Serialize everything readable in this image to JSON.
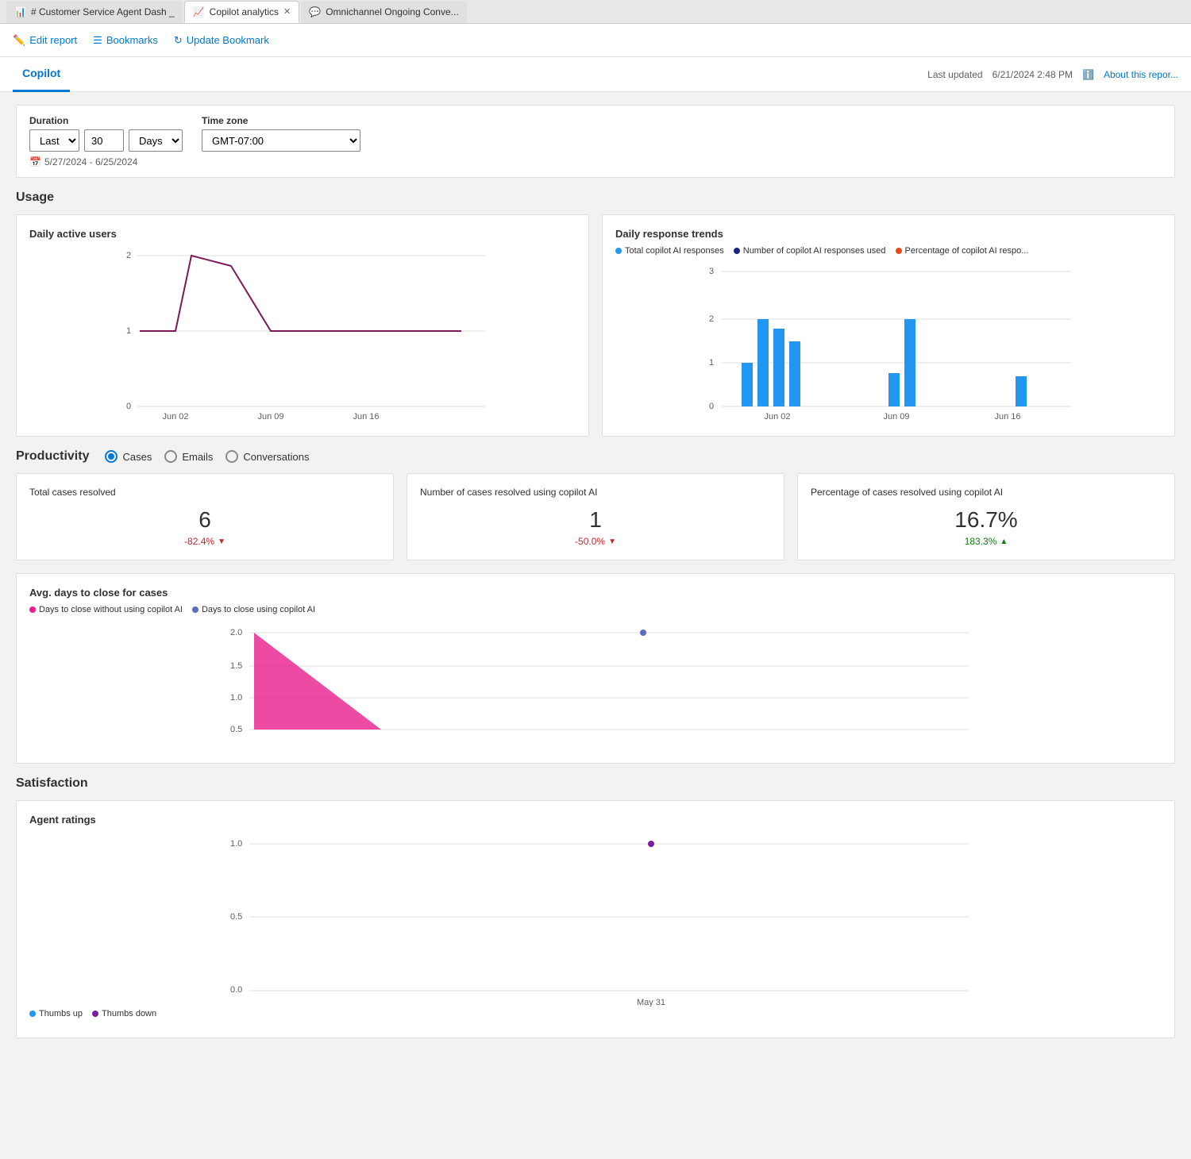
{
  "browser": {
    "tabs": [
      {
        "id": "tab1",
        "icon": "📊",
        "label": "# Customer Service Agent Dash _",
        "active": false,
        "closable": false
      },
      {
        "id": "tab2",
        "icon": "📈",
        "label": "Copilot analytics",
        "active": true,
        "closable": true
      },
      {
        "id": "tab3",
        "icon": "💬",
        "label": "Omnichannel Ongoing Conve...",
        "active": false,
        "closable": false
      }
    ]
  },
  "toolbar": {
    "edit_report": "Edit report",
    "bookmarks": "Bookmarks",
    "update_bookmark": "Update Bookmark"
  },
  "header": {
    "nav_tab": "Copilot",
    "last_updated_label": "Last updated",
    "last_updated_value": "6/21/2024 2:48 PM",
    "about_link": "About this repor..."
  },
  "filters": {
    "duration_label": "Duration",
    "duration_options": [
      "Last"
    ],
    "duration_value": "Last",
    "duration_number": "30",
    "duration_unit_options": [
      "Days"
    ],
    "duration_unit": "Days",
    "timezone_label": "Time zone",
    "timezone_value": "GMT-07:00",
    "date_range": "5/27/2024 - 6/25/2024"
  },
  "usage": {
    "section_title": "Usage",
    "daily_active_users": {
      "title": "Daily active users",
      "y_max": 2,
      "y_mid": 1,
      "y_min": 0,
      "x_labels": [
        "Jun 02",
        "Jun 09",
        "Jun 16"
      ],
      "data_points": [
        {
          "x": 0.12,
          "y": 1.0
        },
        {
          "x": 0.22,
          "y": 2.0
        },
        {
          "x": 0.32,
          "y": 1.8
        },
        {
          "x": 0.55,
          "y": 1.0
        },
        {
          "x": 0.7,
          "y": 1.0
        },
        {
          "x": 0.85,
          "y": 1.0
        },
        {
          "x": 1.0,
          "y": 1.0
        }
      ]
    },
    "daily_response_trends": {
      "title": "Daily response trends",
      "legend": [
        {
          "label": "Total copilot AI responses",
          "color": "#2196f3"
        },
        {
          "label": "Number of copilot AI responses used",
          "color": "#1a237e"
        },
        {
          "label": "Percentage of copilot AI respo...",
          "color": "#e64a19"
        }
      ],
      "y_labels": [
        "3",
        "2",
        "1",
        "0"
      ],
      "x_labels": [
        "Jun 02",
        "Jun 09",
        "Jun 16"
      ],
      "bars": [
        {
          "x_pos": 0.09,
          "height_ratio": 0.4,
          "color": "#2196f3"
        },
        {
          "x_pos": 0.13,
          "height_ratio": 0.65,
          "color": "#2196f3"
        },
        {
          "x_pos": 0.17,
          "height_ratio": 0.6,
          "color": "#2196f3"
        },
        {
          "x_pos": 0.21,
          "height_ratio": 0.5,
          "color": "#2196f3"
        },
        {
          "x_pos": 0.55,
          "height_ratio": 0.35,
          "color": "#2196f3"
        },
        {
          "x_pos": 0.59,
          "height_ratio": 0.65,
          "color": "#2196f3"
        },
        {
          "x_pos": 0.9,
          "height_ratio": 0.33,
          "color": "#2196f3"
        }
      ]
    }
  },
  "productivity": {
    "section_title": "Productivity",
    "radio_options": [
      "Cases",
      "Emails",
      "Conversations"
    ],
    "selected_radio": "Cases",
    "metrics": [
      {
        "label": "Total cases resolved",
        "value": "6",
        "delta": "-82.4%",
        "delta_direction": "down"
      },
      {
        "label": "Number of cases resolved using copilot AI",
        "value": "1",
        "delta": "-50.0%",
        "delta_direction": "down"
      },
      {
        "label": "Percentage of cases resolved using copilot AI",
        "value": "16.7%",
        "delta": "183.3%",
        "delta_direction": "up"
      }
    ],
    "avg_days_chart": {
      "title": "Avg. days to close for cases",
      "legend": [
        {
          "label": "Days to close without using copilot AI",
          "color": "#e91e8c"
        },
        {
          "label": "Days to close using copilot AI",
          "color": "#5c6bc0"
        }
      ],
      "y_labels": [
        "2.0",
        "1.5",
        "1.0",
        "0.5"
      ],
      "x_labels": []
    }
  },
  "satisfaction": {
    "section_title": "Satisfaction",
    "agent_ratings": {
      "title": "Agent ratings",
      "y_labels": [
        "1.0",
        "0.5",
        "0.0"
      ],
      "x_labels": [
        "May 31"
      ],
      "legend": [
        {
          "label": "Thumbs up",
          "color": "#2196f3"
        },
        {
          "label": "Thumbs down",
          "color": "#7b1fa2"
        }
      ]
    }
  }
}
